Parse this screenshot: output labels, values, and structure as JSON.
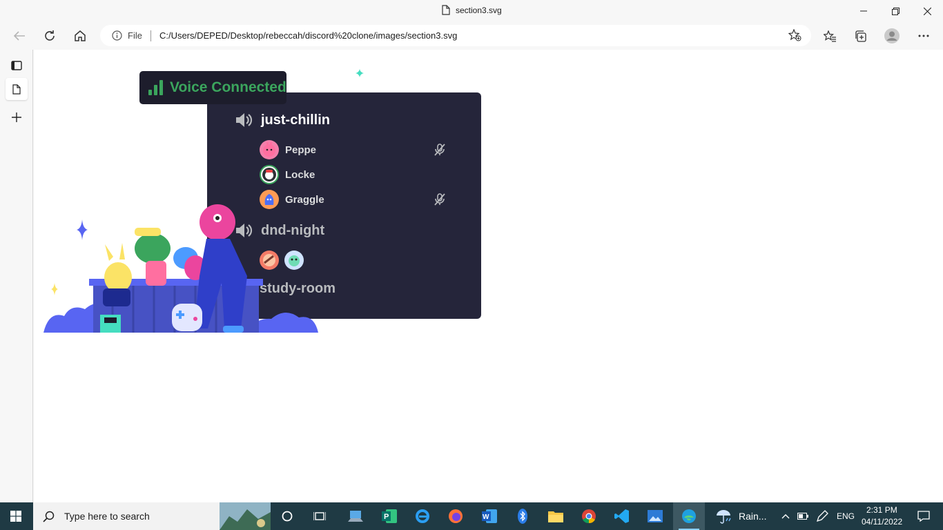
{
  "window": {
    "title": "section3.svg"
  },
  "addressbar": {
    "info_label": "File",
    "url": "C:/Users/DEPED/Desktop/rebeccah/discord%20clone/images/section3.svg"
  },
  "panel": {
    "badge_label": "Voice Connected",
    "channels": [
      {
        "name": "just-chillin",
        "users": [
          "Peppe",
          "Locke",
          "Graggle"
        ]
      },
      {
        "name": "dnd-night"
      },
      {
        "name": "study-room"
      }
    ]
  },
  "colors": {
    "voice_green": "#3ba55d",
    "panel_bg": "#25253a",
    "badge_bg": "#1d1d2c"
  },
  "taskbar": {
    "search_placeholder": "Type here to search",
    "weather": "Rain...",
    "language": "ENG",
    "time": "2:31 PM",
    "date": "04/11/2022"
  }
}
